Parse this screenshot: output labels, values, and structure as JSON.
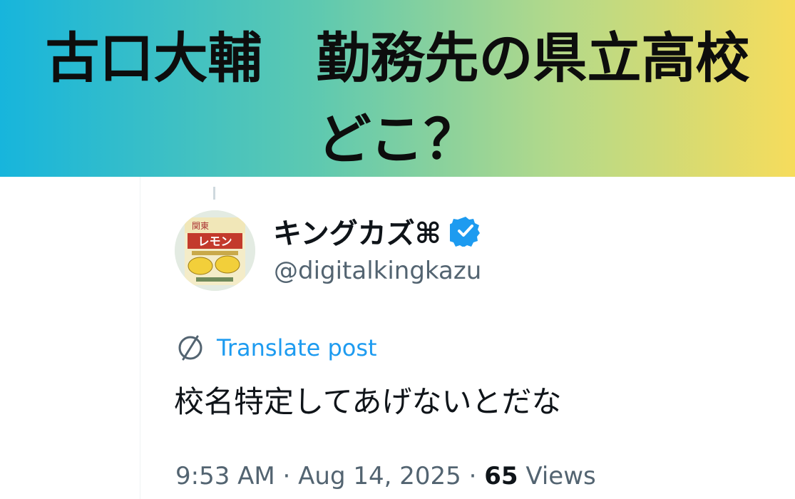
{
  "banner": {
    "line1": "古口大輔　勤務先の県立高校",
    "line2": "どこ？",
    "gradient_start": "#17b5dc",
    "gradient_end": "#f6dc5c"
  },
  "post": {
    "author": {
      "display_name": "キングカズ⌘",
      "handle": "@digitalkingkazu",
      "verified": true,
      "avatar_icon": "lemon-drink-bottle-cap",
      "avatar_text_top": "関東",
      "avatar_text_brand": "レモン"
    },
    "translate_label": "Translate post",
    "text": "校名特定してあげないとだな",
    "timestamp": "9:53 AM · Aug 14, 2025 · ",
    "views_count": "65",
    "views_label": " Views"
  },
  "colors": {
    "accent": "#1d9bf0",
    "text_primary": "#0f1419",
    "text_secondary": "#536471"
  }
}
